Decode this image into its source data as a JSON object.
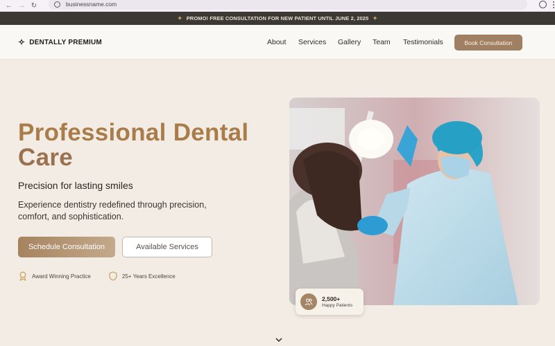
{
  "browser": {
    "url": "businessname.com"
  },
  "promo": {
    "text": "PROMO! FREE CONSULTATION FOR NEW PATIENT UNTIL JUNE 2, 2025"
  },
  "header": {
    "brand": "DENTALLY PREMIUM",
    "nav": [
      "About",
      "Services",
      "Gallery",
      "Team",
      "Testimonials"
    ],
    "cta": "Book Consultation"
  },
  "hero": {
    "title_line1": "Professional Dental",
    "title_line2": "Care",
    "tagline": "Precision for lasting smiles",
    "description": "Experience dentistry redefined through precision, comfort, and sophistication.",
    "primary_cta": "Schedule Consultation",
    "secondary_cta": "Available Services",
    "badges": [
      {
        "icon": "award-icon",
        "label": "Award Winning Practice"
      },
      {
        "icon": "shield-icon",
        "label": "25+ Years Excellence"
      }
    ],
    "stat": {
      "icon": "users-icon",
      "value": "2,500+",
      "label": "Happy Patients"
    }
  },
  "colors": {
    "accent": "#a07f62",
    "title_gold": "#a97c4a",
    "promo_bg": "#3c3834",
    "page_bg": "#f3ece4"
  }
}
